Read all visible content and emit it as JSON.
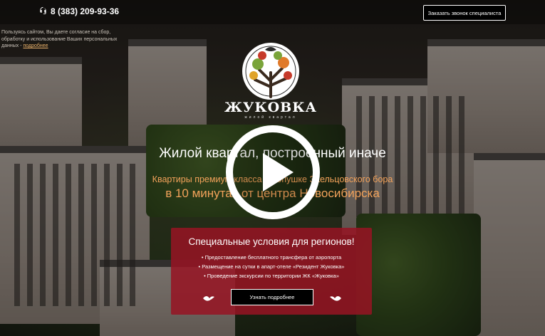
{
  "header": {
    "phone": "8 (383) 209-93-36",
    "call_button": "Заказать звонок специалиста"
  },
  "consent": {
    "text": "Пользуясь сайтом, Вы даете согласие на сбор, обработку и использование Ваших персональных данных - ",
    "link": "подробнее"
  },
  "brand": {
    "name": "ЖУКОВКА",
    "subtitle": "жилой квартал"
  },
  "hero": {
    "headline": "Жилой квартал, построенный иначе",
    "subheadline": "Квартиры премиум-класса на опушке Заельцовского бора",
    "tagline": "в 10 минутах от центра Новосибирска"
  },
  "promo": {
    "title": "Специальные условия для регионов!",
    "items": [
      "• Предоставление бесплатного трансфера от аэропорта",
      "• Размещение на сутки в апарт-отеле «Резидент Жуковка»",
      "• Проведение экскурсии по территории ЖК «Жуковка»"
    ],
    "button": "Узнать подробнее"
  },
  "colors": {
    "accent_orange": "#f2a25a",
    "promo_red": "#96142380",
    "link_orange": "#e8b16a"
  },
  "icons": {
    "phone": "phone-icon",
    "logo": "tree-logo-icon",
    "play": "play-icon",
    "bird": "bird-icon"
  }
}
